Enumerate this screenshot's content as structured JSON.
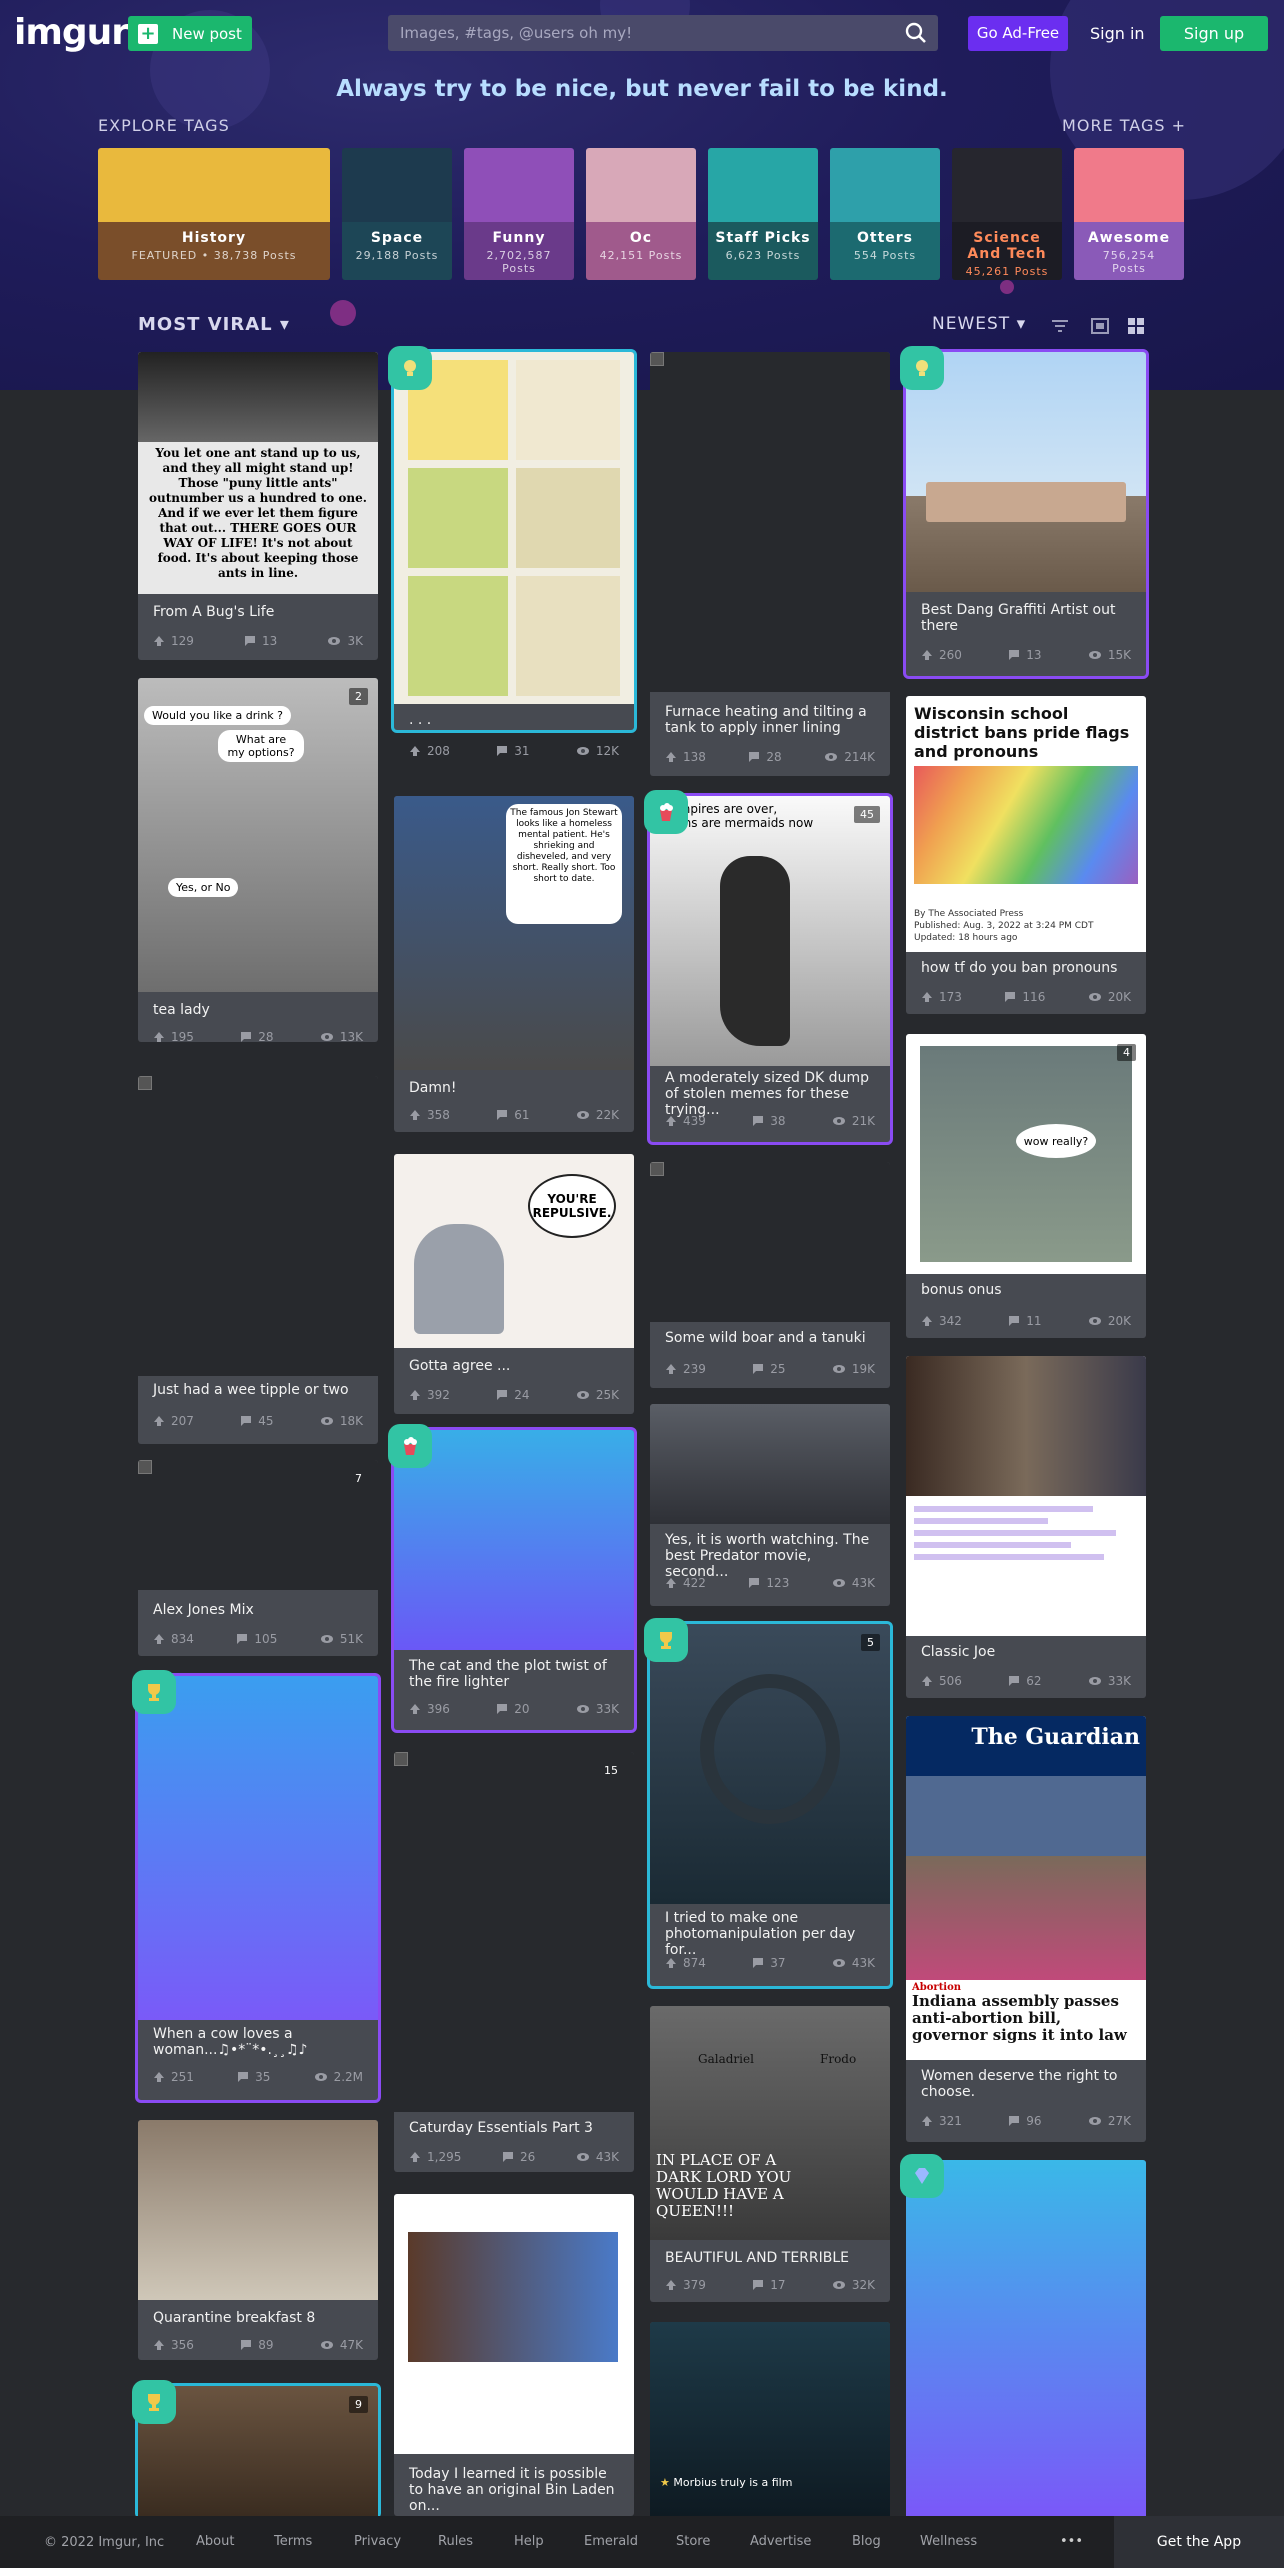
{
  "header": {
    "logo": "imgur",
    "new_post": "New post",
    "search_placeholder": "Images, #tags, @users oh my!",
    "ad_free": "Go Ad-Free",
    "sign_in": "Sign in",
    "sign_up": "Sign up"
  },
  "tagline": "Always try to be nice, but never fail to be kind.",
  "explore": {
    "title": "EXPLORE TAGS",
    "more": "MORE TAGS +",
    "tags": [
      {
        "name": "History",
        "count": "FEATURED • 38,738 Posts",
        "color": "#7a4e2a",
        "art": "#e9b93d"
      },
      {
        "name": "Space",
        "count": "29,188 Posts",
        "color": "#1d4656",
        "art": "#1d3a4e"
      },
      {
        "name": "Funny",
        "count": "2,702,587 Posts",
        "color": "#6a3a8a",
        "art": "#8f4fb8"
      },
      {
        "name": "Oc",
        "count": "42,151 Posts",
        "color": "#a05a8c",
        "art": "#d8a8b8"
      },
      {
        "name": "Staff Picks",
        "count": "6,623 Posts",
        "color": "#1b5a5e",
        "art": "#27a6a6"
      },
      {
        "name": "Otters",
        "count": "554 Posts",
        "color": "#1c6a70",
        "art": "#2ea0aa"
      },
      {
        "name": "Science And Tech",
        "count": "45,261 Posts",
        "color": "#1c1c24",
        "art": "#26262e"
      },
      {
        "name": "Awesome",
        "count": "756,254 Posts",
        "color": "#8a5ab8",
        "art": "#f07a8a"
      }
    ]
  },
  "feed": {
    "sort": "MOST VIRAL",
    "order": "NEWEST"
  },
  "posts": {
    "c1": [
      {
        "title": "From A Bug's Life",
        "up": "129",
        "comments": "13",
        "views": "3K"
      },
      {
        "title": "tea lady",
        "up": "195",
        "comments": "28",
        "views": "13K",
        "count": "2"
      },
      {
        "title": "Just had a wee tipple or two",
        "up": "207",
        "comments": "45",
        "views": "18K"
      },
      {
        "title": "Alex Jones Mix",
        "up": "834",
        "comments": "105",
        "views": "51K",
        "count": "7"
      },
      {
        "title": "When a cow loves a woman...♫•*¨*•.¸¸♫♪",
        "up": "251",
        "comments": "35",
        "views": "2.2M"
      },
      {
        "title": "Quarantine breakfast 8",
        "up": "356",
        "comments": "89",
        "views": "47K"
      },
      {
        "count": "9"
      }
    ],
    "c2": [
      {
        "title": ". . .",
        "up": "208",
        "comments": "31",
        "views": "12K"
      },
      {
        "title": "Damn!",
        "up": "358",
        "comments": "61",
        "views": "22K"
      },
      {
        "title": "Gotta agree ...",
        "up": "392",
        "comments": "24",
        "views": "25K"
      },
      {
        "title": "The cat and the plot twist of the fire lighter",
        "up": "396",
        "comments": "20",
        "views": "33K"
      },
      {
        "title": "Caturday Essentials Part 3",
        "up": "1,295",
        "comments": "26",
        "views": "43K",
        "count": "15"
      },
      {
        "title": "Today I learned it is possible to have an original Bin Laden on..."
      }
    ],
    "c3": [
      {
        "title": "Furnace heating and tilting a tank to apply inner lining",
        "up": "138",
        "comments": "28",
        "views": "214K"
      },
      {
        "title": "A moderately sized DK dump of stolen memes for these trying...",
        "up": "439",
        "comments": "38",
        "views": "21K",
        "count": "45"
      },
      {
        "title": "Some wild boar and a tanuki",
        "up": "239",
        "comments": "25",
        "views": "19K"
      },
      {
        "title": "Yes, it is worth watching. The best Predator movie, second...",
        "up": "422",
        "comments": "123",
        "views": "43K"
      },
      {
        "title": "I tried to make one photomanipulation per day for...",
        "up": "874",
        "comments": "37",
        "views": "43K",
        "count": "5"
      },
      {
        "title": "BEAUTIFUL AND TERRIBLE",
        "up": "379",
        "comments": "17",
        "views": "32K"
      },
      {
        "title": ""
      }
    ],
    "c4": [
      {
        "title": "Best Dang Graffiti Artist out there",
        "up": "260",
        "comments": "13",
        "views": "15K"
      },
      {
        "title": "how tf do you ban pronouns",
        "up": "173",
        "comments": "116",
        "views": "20K"
      },
      {
        "title": "bonus onus",
        "up": "342",
        "comments": "11",
        "views": "20K",
        "count": "4"
      },
      {
        "title": "Classic Joe",
        "up": "506",
        "comments": "62",
        "views": "33K"
      },
      {
        "title": "Women deserve the right to choose.",
        "up": "321",
        "comments": "96",
        "views": "27K"
      },
      {
        "title": ""
      }
    ]
  },
  "image_text": {
    "bugs": "You let one ant stand up to us, and they all might stand up! Those \"puny little ants\" outnumber us a hundred to one. And if we ever let them figure that out... THERE GOES OUR WAY OF LIFE! It's not about food. It's about keeping those ants in line.",
    "drink": "Would you like a drink ?",
    "options": "What are my options?",
    "yesno": "Yes, or No",
    "news_head": "Wisconsin school district bans pride flags and pronouns",
    "news_by": "By The Associated Press",
    "news_pub": "Published: Aug. 3, 2022 at 3:24 PM CDT",
    "news_upd": "Updated: 18 hours ago",
    "guardian": "The Guardian",
    "abortion_tag": "Abortion",
    "abortion_head": "Indiana assembly passes anti-abortion bill, governor signs it into law",
    "repulsive": "YOU'RE REPULSIVE.",
    "wow": "wow really?",
    "galadriel": "Galadriel",
    "frodo": "Frodo",
    "queen": "IN PLACE OF A DARK LORD YOU WOULD HAVE A QUEEN!!!",
    "morbius": "Morbius truly is a film",
    "vampires": "Vampires are over, goths are mermaids now",
    "stewart": "The famous Jon Stewart looks like a homeless mental patient. He's shrieking and disheveled, and very short. Really short. Too short to date."
  },
  "footer": {
    "copyright": "© 2022 Imgur, Inc",
    "links": [
      "About",
      "Terms",
      "Privacy",
      "Rules",
      "Help",
      "Emerald",
      "Store",
      "Advertise",
      "Blog",
      "Wellness"
    ],
    "more": "•••",
    "get_app": "Get the App"
  }
}
